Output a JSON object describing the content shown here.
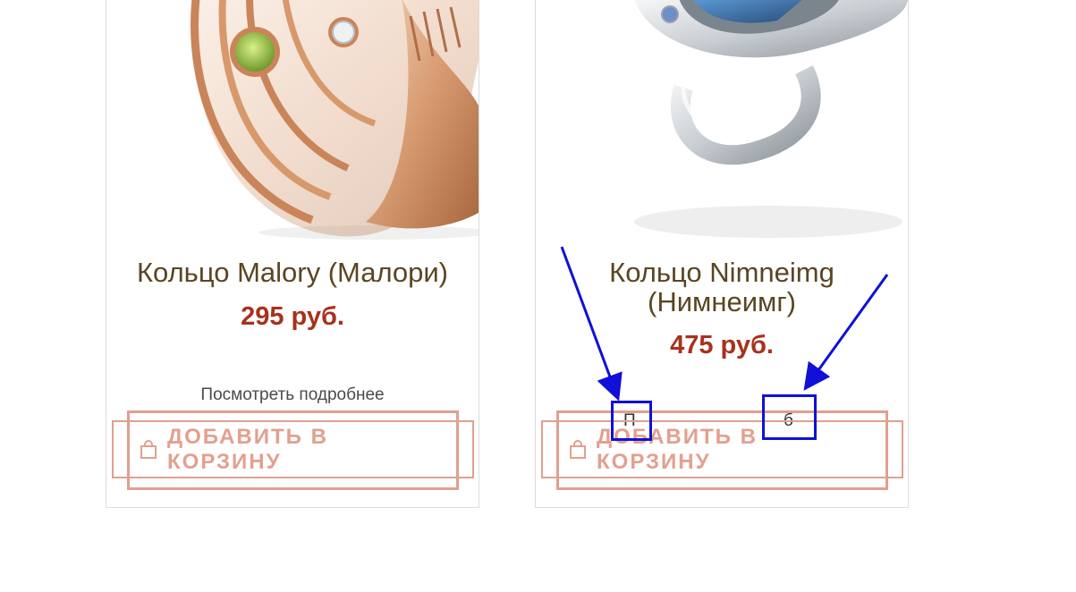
{
  "products": [
    {
      "title": "Кольцо Malory (Малори)",
      "price": "295 руб.",
      "details_link": "Посмотреть подробнее",
      "cart_button": "ДОБАВИТЬ В КОРЗИНУ"
    },
    {
      "title_line1": "Кольцо Nimneimg",
      "title_line2": "(Нимнеимг)",
      "price": "475 руб.",
      "cart_button": "ДОБАВИТЬ В КОРЗИНУ",
      "partial_glyph_left": "П",
      "partial_glyph_right": "б"
    }
  ],
  "colors": {
    "title": "#5a4522",
    "price": "#a8311d",
    "cart_border": "#e1a08f",
    "annotation": "#1010d8"
  },
  "icons": [
    "shopping-bag-icon",
    "gold-ring-image",
    "silver-ring-image"
  ]
}
